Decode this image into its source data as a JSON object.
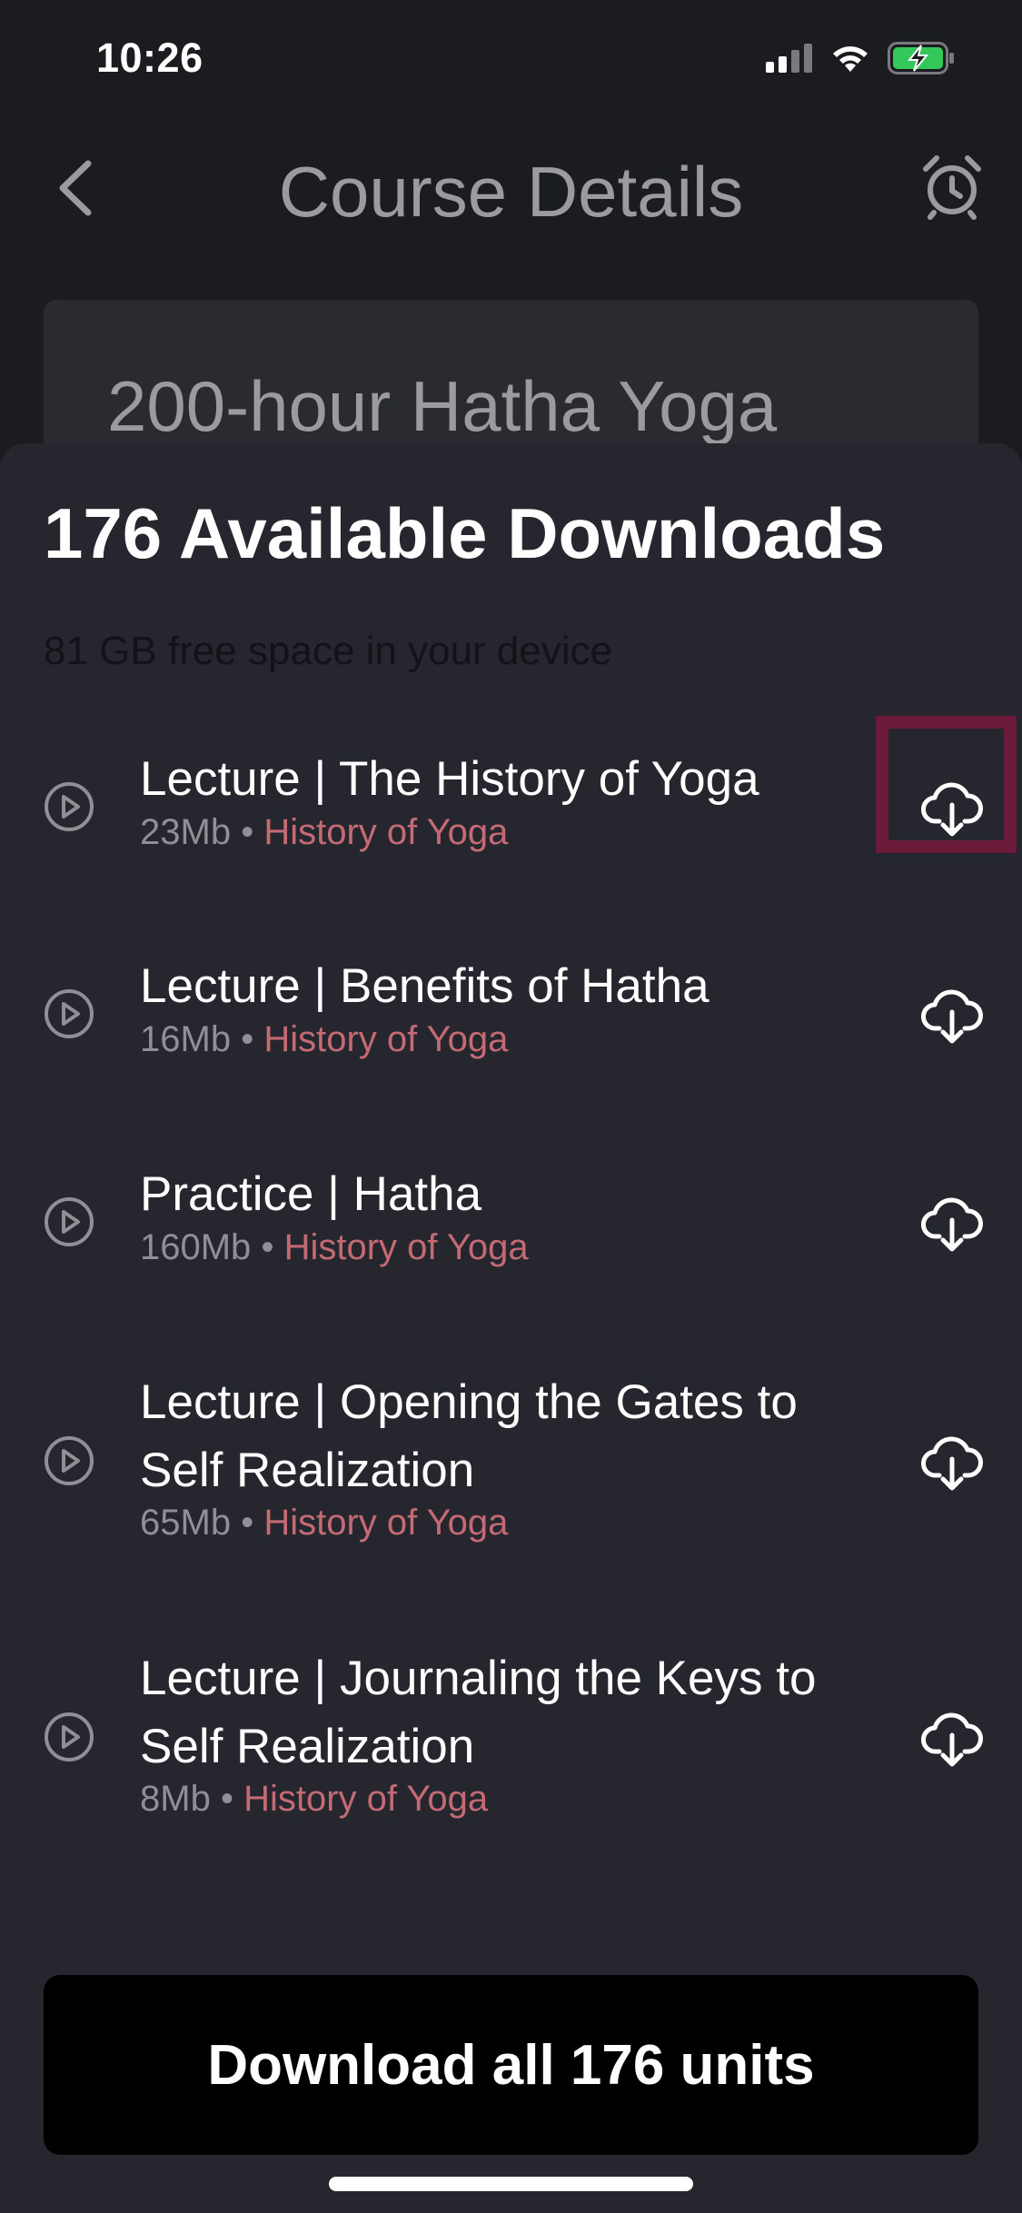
{
  "status_bar": {
    "time": "10:26"
  },
  "header": {
    "title": "Course Details",
    "back_icon": "chevron-left-icon",
    "alarm_icon": "alarm-clock-icon"
  },
  "course": {
    "title": "200-hour Hatha Yoga"
  },
  "sheet": {
    "title": "176 Available Downloads",
    "free_space": "81 GB free space in your device",
    "items": [
      {
        "title": "Lecture | The History of Yoga",
        "size": "23Mb",
        "separator": "•",
        "category": "History of Yoga"
      },
      {
        "title": "Lecture | Benefits of Hatha",
        "size": "16Mb",
        "separator": "•",
        "category": "History of Yoga"
      },
      {
        "title": "Practice | Hatha",
        "size": "160Mb",
        "separator": "•",
        "category": "History of Yoga"
      },
      {
        "title": "Lecture | Opening the Gates to Self Realization",
        "size": "65Mb",
        "separator": "•",
        "category": "History of Yoga"
      },
      {
        "title": "Lecture | Journaling the Keys to Self Realization",
        "size": "8Mb",
        "separator": "•",
        "category": "History of Yoga"
      }
    ],
    "download_all_label": "Download all 176 units"
  },
  "colors": {
    "background": "#1b1c20",
    "sheet": "#25262e",
    "accent_category": "#c46a74",
    "highlight": "#6b1a3a",
    "battery_green": "#34c759"
  }
}
